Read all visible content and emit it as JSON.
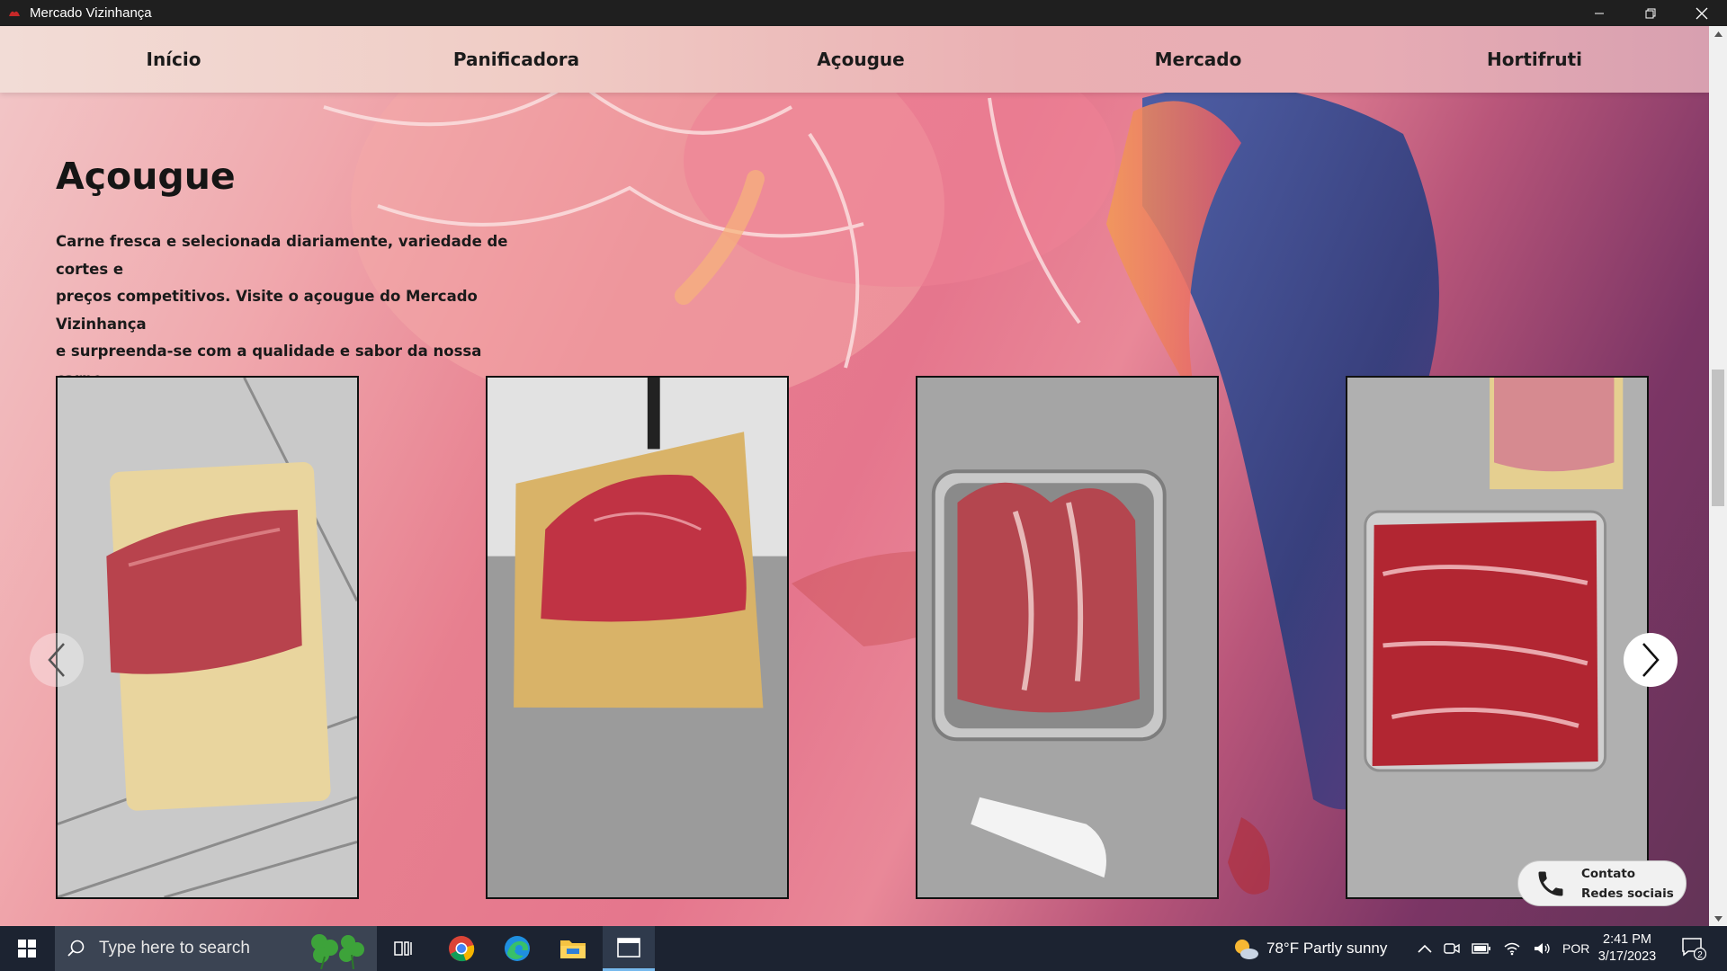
{
  "window": {
    "title": "Mercado Vizinhança",
    "icon": "app-logo-icon"
  },
  "nav": {
    "items": [
      {
        "label": "Início"
      },
      {
        "label": "Panificadora"
      },
      {
        "label": "Açougue"
      },
      {
        "label": "Mercado"
      },
      {
        "label": "Hortifruti"
      }
    ]
  },
  "section": {
    "title": "Açougue",
    "description_lines": [
      "Carne fresca e selecionada diariamente, variedade de cortes e",
      "preços competitivos. Visite o açougue do Mercado Vizinhança",
      "e surpreenda-se com a qualidade e sabor da nossa carne."
    ]
  },
  "carousel": {
    "images": [
      "meat-block-on-board",
      "meat-cut-on-board",
      "meat-in-steel-tray",
      "meat-pieces-in-tray"
    ],
    "prev_icon": "chevron-left-icon",
    "next_icon": "chevron-right-icon"
  },
  "contact": {
    "line1": "Contato",
    "line2": "Redes sociais",
    "icon": "phone-icon"
  },
  "taskbar": {
    "search_placeholder": "Type here to search",
    "weather": "78°F  Partly sunny",
    "language": "POR",
    "time": "2:41 PM",
    "date": "3/17/2023",
    "notification_count": "2"
  },
  "colors": {
    "titlebar": "#1f1f1f",
    "taskbar": "#1c2331",
    "accent": "#76b9ed"
  }
}
